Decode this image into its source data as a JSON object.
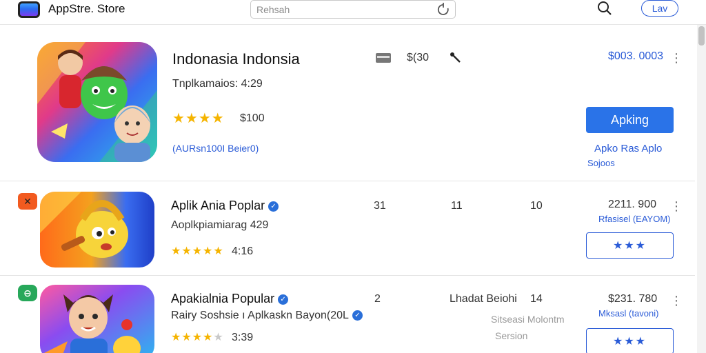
{
  "topbar": {
    "app_title": "AppStre. Store",
    "search_placeholder": "Rehsah",
    "lang_label": "Lav",
    "icons": {
      "app": "app-store-icon",
      "refresh": "refresh-icon",
      "search": "search-icon"
    }
  },
  "featured": {
    "title": "Indonasia Indonsia",
    "subtitle": "Tnplkamaios: 4:29",
    "rating_label": "$100",
    "stars": 4,
    "link": "(AURsn100I Beier0)",
    "meta_price": "$(30",
    "price": "$003. 0003",
    "button": "Apking",
    "side_link_line1": "Apko Ras Aplo",
    "side_link_line2": "Sojoos",
    "icons": {
      "card": "card-icon",
      "tool": "wrench-icon",
      "more": "more-icon"
    }
  },
  "apps": [
    {
      "badge": "✕",
      "title": "Aplik Ania Poplar",
      "subtitle": "Aoplkpiamiarag 429",
      "stars": 5,
      "rating_label": "4:16",
      "col1": "31",
      "col2": "11",
      "col3": "10",
      "price": "2211. 900",
      "price_sub": "Rfasisel (EAYOM)",
      "button": "★★★"
    },
    {
      "badge": "⊖",
      "title": "Apakialnia Popular",
      "subtitle": "Rairy Soshsie ı Aplkaskn Bayon(20L",
      "stars": 4,
      "rating_label": "3:39",
      "col1": "2",
      "col2": "Lhadat Beiohi",
      "col3": "14",
      "faded_line1": "Sitseasi Molontm",
      "faded_line2": "Sersion",
      "price": "$231. 780",
      "price_sub": "Mksasl (tavoni)",
      "button": "★★★"
    }
  ],
  "colors": {
    "accent": "#2a73e8",
    "link": "#2a5bd7",
    "star": "#f5b400",
    "badge_orange": "#f25a1f",
    "badge_green": "#27a85a"
  }
}
